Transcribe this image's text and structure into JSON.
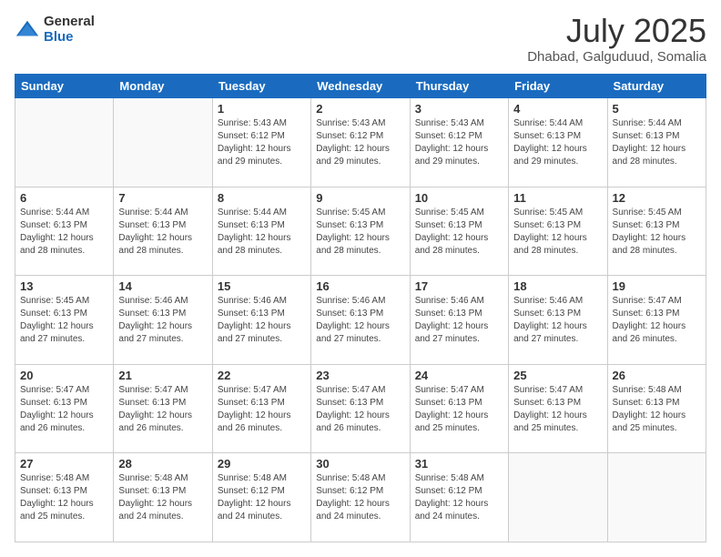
{
  "logo": {
    "general": "General",
    "blue": "Blue"
  },
  "header": {
    "title": "July 2025",
    "subtitle": "Dhabad, Galguduud, Somalia"
  },
  "weekdays": [
    "Sunday",
    "Monday",
    "Tuesday",
    "Wednesday",
    "Thursday",
    "Friday",
    "Saturday"
  ],
  "weeks": [
    [
      {
        "day": "",
        "sunrise": "",
        "sunset": "",
        "daylight": ""
      },
      {
        "day": "",
        "sunrise": "",
        "sunset": "",
        "daylight": ""
      },
      {
        "day": "1",
        "sunrise": "Sunrise: 5:43 AM",
        "sunset": "Sunset: 6:12 PM",
        "daylight": "Daylight: 12 hours and 29 minutes."
      },
      {
        "day": "2",
        "sunrise": "Sunrise: 5:43 AM",
        "sunset": "Sunset: 6:12 PM",
        "daylight": "Daylight: 12 hours and 29 minutes."
      },
      {
        "day": "3",
        "sunrise": "Sunrise: 5:43 AM",
        "sunset": "Sunset: 6:12 PM",
        "daylight": "Daylight: 12 hours and 29 minutes."
      },
      {
        "day": "4",
        "sunrise": "Sunrise: 5:44 AM",
        "sunset": "Sunset: 6:13 PM",
        "daylight": "Daylight: 12 hours and 29 minutes."
      },
      {
        "day": "5",
        "sunrise": "Sunrise: 5:44 AM",
        "sunset": "Sunset: 6:13 PM",
        "daylight": "Daylight: 12 hours and 28 minutes."
      }
    ],
    [
      {
        "day": "6",
        "sunrise": "Sunrise: 5:44 AM",
        "sunset": "Sunset: 6:13 PM",
        "daylight": "Daylight: 12 hours and 28 minutes."
      },
      {
        "day": "7",
        "sunrise": "Sunrise: 5:44 AM",
        "sunset": "Sunset: 6:13 PM",
        "daylight": "Daylight: 12 hours and 28 minutes."
      },
      {
        "day": "8",
        "sunrise": "Sunrise: 5:44 AM",
        "sunset": "Sunset: 6:13 PM",
        "daylight": "Daylight: 12 hours and 28 minutes."
      },
      {
        "day": "9",
        "sunrise": "Sunrise: 5:45 AM",
        "sunset": "Sunset: 6:13 PM",
        "daylight": "Daylight: 12 hours and 28 minutes."
      },
      {
        "day": "10",
        "sunrise": "Sunrise: 5:45 AM",
        "sunset": "Sunset: 6:13 PM",
        "daylight": "Daylight: 12 hours and 28 minutes."
      },
      {
        "day": "11",
        "sunrise": "Sunrise: 5:45 AM",
        "sunset": "Sunset: 6:13 PM",
        "daylight": "Daylight: 12 hours and 28 minutes."
      },
      {
        "day": "12",
        "sunrise": "Sunrise: 5:45 AM",
        "sunset": "Sunset: 6:13 PM",
        "daylight": "Daylight: 12 hours and 28 minutes."
      }
    ],
    [
      {
        "day": "13",
        "sunrise": "Sunrise: 5:45 AM",
        "sunset": "Sunset: 6:13 PM",
        "daylight": "Daylight: 12 hours and 27 minutes."
      },
      {
        "day": "14",
        "sunrise": "Sunrise: 5:46 AM",
        "sunset": "Sunset: 6:13 PM",
        "daylight": "Daylight: 12 hours and 27 minutes."
      },
      {
        "day": "15",
        "sunrise": "Sunrise: 5:46 AM",
        "sunset": "Sunset: 6:13 PM",
        "daylight": "Daylight: 12 hours and 27 minutes."
      },
      {
        "day": "16",
        "sunrise": "Sunrise: 5:46 AM",
        "sunset": "Sunset: 6:13 PM",
        "daylight": "Daylight: 12 hours and 27 minutes."
      },
      {
        "day": "17",
        "sunrise": "Sunrise: 5:46 AM",
        "sunset": "Sunset: 6:13 PM",
        "daylight": "Daylight: 12 hours and 27 minutes."
      },
      {
        "day": "18",
        "sunrise": "Sunrise: 5:46 AM",
        "sunset": "Sunset: 6:13 PM",
        "daylight": "Daylight: 12 hours and 27 minutes."
      },
      {
        "day": "19",
        "sunrise": "Sunrise: 5:47 AM",
        "sunset": "Sunset: 6:13 PM",
        "daylight": "Daylight: 12 hours and 26 minutes."
      }
    ],
    [
      {
        "day": "20",
        "sunrise": "Sunrise: 5:47 AM",
        "sunset": "Sunset: 6:13 PM",
        "daylight": "Daylight: 12 hours and 26 minutes."
      },
      {
        "day": "21",
        "sunrise": "Sunrise: 5:47 AM",
        "sunset": "Sunset: 6:13 PM",
        "daylight": "Daylight: 12 hours and 26 minutes."
      },
      {
        "day": "22",
        "sunrise": "Sunrise: 5:47 AM",
        "sunset": "Sunset: 6:13 PM",
        "daylight": "Daylight: 12 hours and 26 minutes."
      },
      {
        "day": "23",
        "sunrise": "Sunrise: 5:47 AM",
        "sunset": "Sunset: 6:13 PM",
        "daylight": "Daylight: 12 hours and 26 minutes."
      },
      {
        "day": "24",
        "sunrise": "Sunrise: 5:47 AM",
        "sunset": "Sunset: 6:13 PM",
        "daylight": "Daylight: 12 hours and 25 minutes."
      },
      {
        "day": "25",
        "sunrise": "Sunrise: 5:47 AM",
        "sunset": "Sunset: 6:13 PM",
        "daylight": "Daylight: 12 hours and 25 minutes."
      },
      {
        "day": "26",
        "sunrise": "Sunrise: 5:48 AM",
        "sunset": "Sunset: 6:13 PM",
        "daylight": "Daylight: 12 hours and 25 minutes."
      }
    ],
    [
      {
        "day": "27",
        "sunrise": "Sunrise: 5:48 AM",
        "sunset": "Sunset: 6:13 PM",
        "daylight": "Daylight: 12 hours and 25 minutes."
      },
      {
        "day": "28",
        "sunrise": "Sunrise: 5:48 AM",
        "sunset": "Sunset: 6:13 PM",
        "daylight": "Daylight: 12 hours and 24 minutes."
      },
      {
        "day": "29",
        "sunrise": "Sunrise: 5:48 AM",
        "sunset": "Sunset: 6:12 PM",
        "daylight": "Daylight: 12 hours and 24 minutes."
      },
      {
        "day": "30",
        "sunrise": "Sunrise: 5:48 AM",
        "sunset": "Sunset: 6:12 PM",
        "daylight": "Daylight: 12 hours and 24 minutes."
      },
      {
        "day": "31",
        "sunrise": "Sunrise: 5:48 AM",
        "sunset": "Sunset: 6:12 PM",
        "daylight": "Daylight: 12 hours and 24 minutes."
      },
      {
        "day": "",
        "sunrise": "",
        "sunset": "",
        "daylight": ""
      },
      {
        "day": "",
        "sunrise": "",
        "sunset": "",
        "daylight": ""
      }
    ]
  ]
}
